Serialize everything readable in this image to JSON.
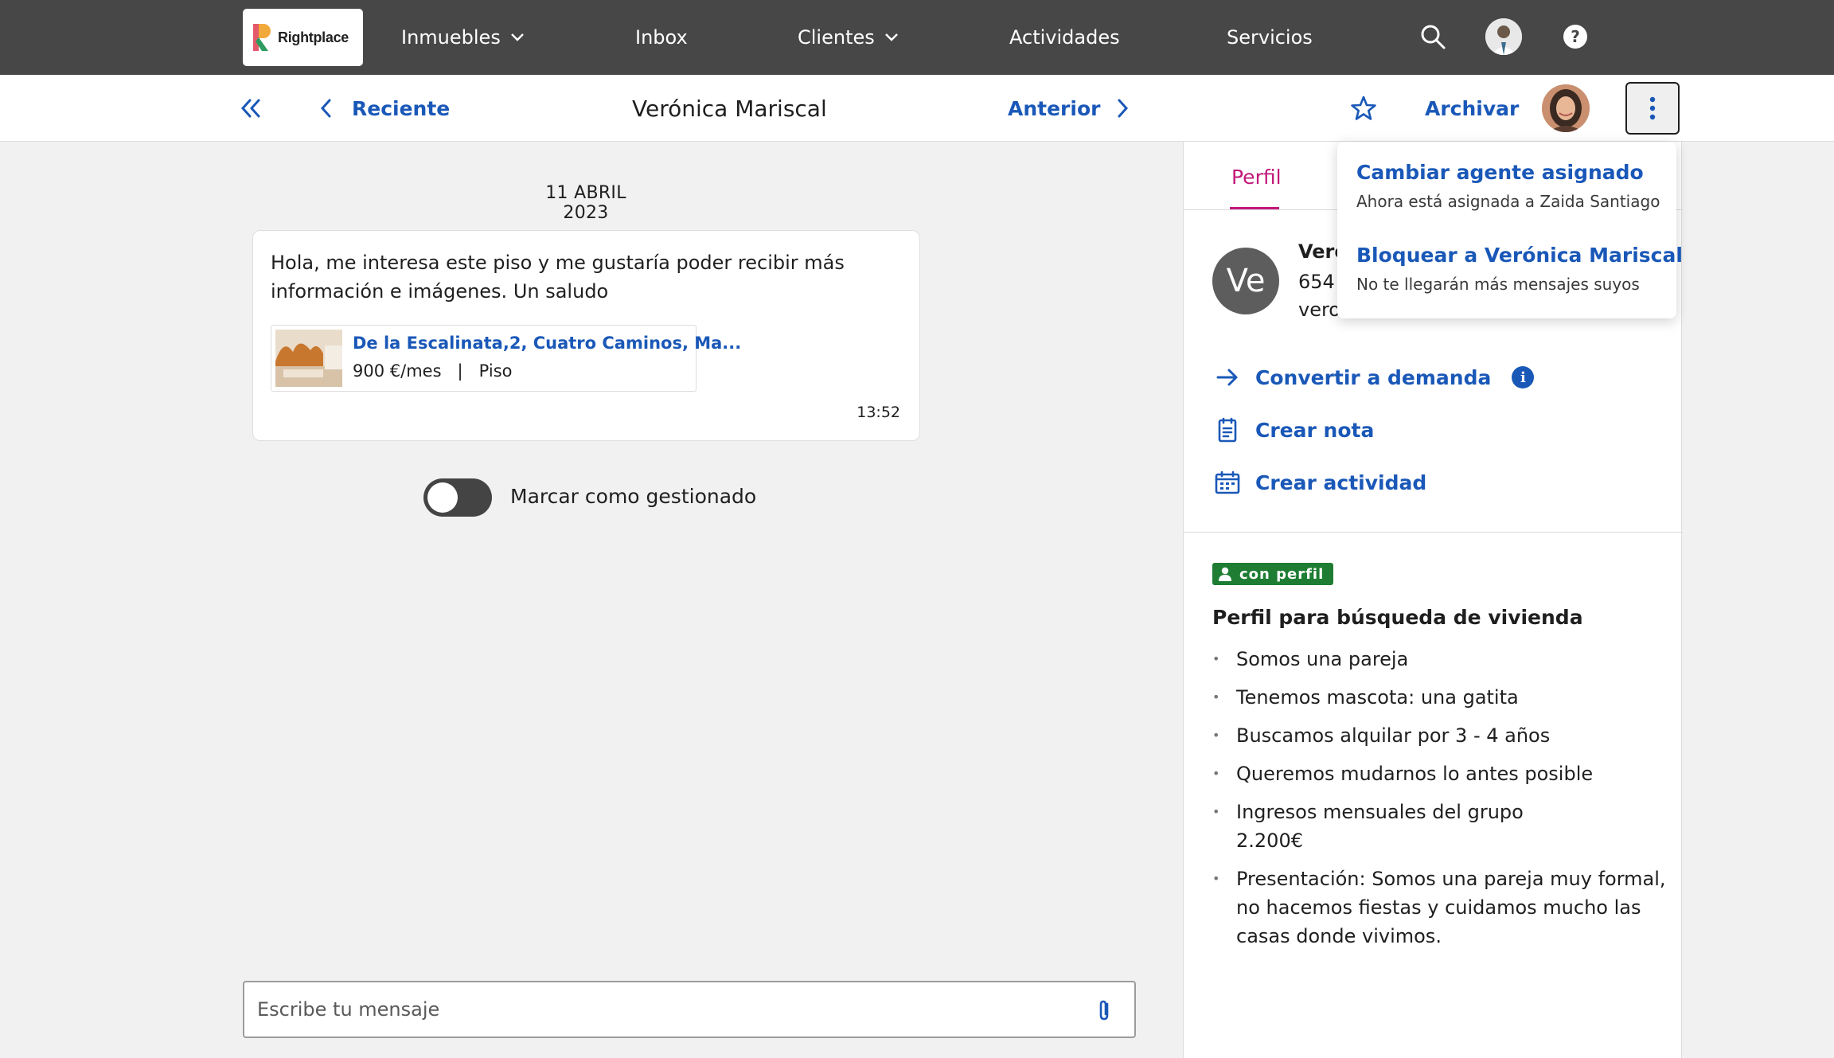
{
  "topnav": {
    "logo_text": "Rightplace",
    "items": [
      {
        "label": "Inmuebles",
        "has_dropdown": true
      },
      {
        "label": "Inbox",
        "has_dropdown": false
      },
      {
        "label": "Clientes",
        "has_dropdown": true
      },
      {
        "label": "Actividades",
        "has_dropdown": false
      },
      {
        "label": "Servicios",
        "has_dropdown": false
      }
    ],
    "icons": [
      "search-icon",
      "user-avatar",
      "help-icon"
    ],
    "background": "#474747"
  },
  "subheader": {
    "back_label": "Reciente",
    "title": "Verónica Mariscal",
    "prev_label": "Anterior",
    "archive_label": "Archivar"
  },
  "conversation": {
    "date": "11 ABRIL 2023",
    "message": {
      "text": "Hola, me interesa este piso y me gustaría poder recibir más información e imágenes. Un saludo",
      "time": "13:52",
      "property": {
        "title": "De la Escalinata,2, Cuatro Caminos, Ma...",
        "price": "900 €/mes",
        "separator": "|",
        "type": "Piso"
      }
    },
    "toggle_label": "Marcar como gestionado",
    "toggle_on": false,
    "composer_placeholder": "Escribe tu mensaje"
  },
  "panel": {
    "tab_label": "Perfil",
    "contact": {
      "initials": "Ve",
      "name_partial": "Veró",
      "phone_partial": "654",
      "email_partial": "vero"
    },
    "actions": [
      {
        "label": "Convertir a demanda",
        "icon": "arrow-right-icon"
      },
      {
        "label": "Crear nota",
        "icon": "note-icon"
      },
      {
        "label": "Crear actividad",
        "icon": "calendar-icon"
      }
    ],
    "badge_label": "con perfil",
    "section_title": "Perfil para búsqueda de vivienda",
    "profile_items": [
      "Somos una pareja",
      "Tenemos mascota: una gatita",
      "Buscamos alquilar por 3 - 4 años",
      "Queremos mudarnos lo antes posible",
      "Ingresos mensuales del grupo 2.200€",
      "Presentación: Somos una pareja muy formal, no hacemos fiestas y cuidamos mucho las casas donde vivimos."
    ]
  },
  "dropdown": {
    "items": [
      {
        "title": "Cambiar agente asignado",
        "subtitle": "Ahora está asignada a Zaida Santiago"
      },
      {
        "title": "Bloquear a Verónica Mariscal",
        "subtitle": "No te llegarán más mensajes suyos"
      }
    ]
  },
  "colors": {
    "link": "#1a58b8",
    "accent": "#c2187a",
    "badge": "#1e7d32"
  }
}
